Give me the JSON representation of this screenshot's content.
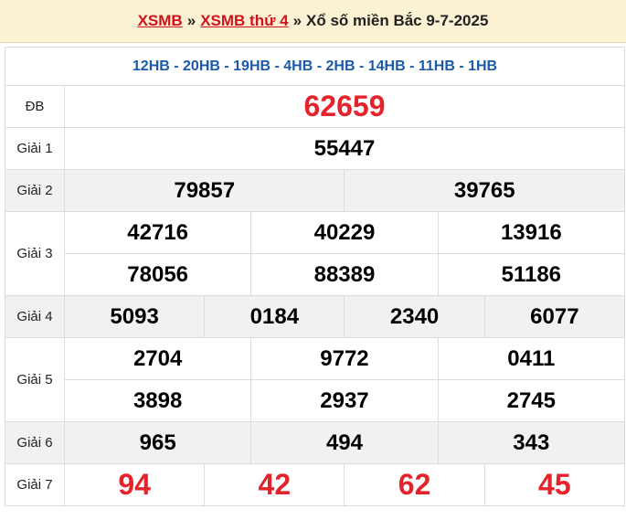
{
  "header": {
    "link1": "XSMB",
    "sep": "»",
    "link2": "XSMB thứ 4",
    "title": "Xổ số miền Bắc 9-7-2025"
  },
  "hb_codes": "12HB - 20HB - 19HB - 4HB - 2HB - 14HB - 11HB - 1HB",
  "prizes": {
    "db": {
      "label": "ĐB",
      "values": [
        "62659"
      ]
    },
    "g1": {
      "label": "Giải 1",
      "values": [
        "55447"
      ]
    },
    "g2": {
      "label": "Giải 2",
      "values": [
        "79857",
        "39765"
      ]
    },
    "g3": {
      "label": "Giải 3",
      "values": [
        "42716",
        "40229",
        "13916",
        "78056",
        "88389",
        "51186"
      ]
    },
    "g4": {
      "label": "Giải 4",
      "values": [
        "5093",
        "0184",
        "2340",
        "6077"
      ]
    },
    "g5": {
      "label": "Giải 5",
      "values": [
        "2704",
        "9772",
        "0411",
        "3898",
        "2937",
        "2745"
      ]
    },
    "g6": {
      "label": "Giải 6",
      "values": [
        "965",
        "494",
        "343"
      ]
    },
    "g7": {
      "label": "Giải 7",
      "values": [
        "94",
        "42",
        "62",
        "45"
      ]
    }
  }
}
